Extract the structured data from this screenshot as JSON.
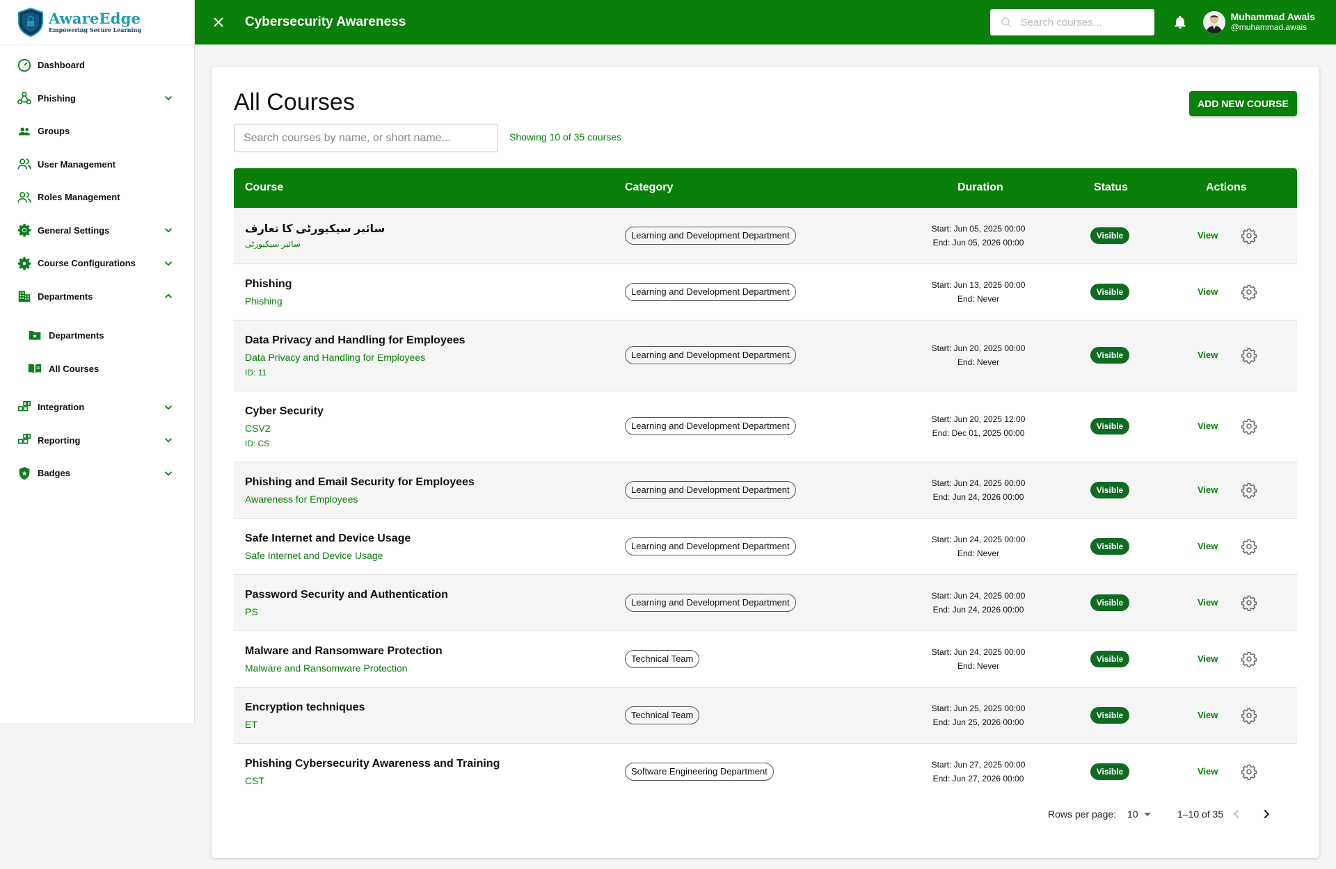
{
  "brand": {
    "name": "AwareEdge",
    "tagline": "Empowering Secure Learning"
  },
  "sidebar": {
    "items": [
      {
        "label": "Dashboard",
        "icon": "gauge-icon",
        "expandable": false
      },
      {
        "label": "Phishing",
        "icon": "webhook-icon",
        "expandable": true,
        "expanded": false
      },
      {
        "label": "Groups",
        "icon": "groups-icon",
        "expandable": false
      },
      {
        "label": "User Management",
        "icon": "users-icon",
        "expandable": false
      },
      {
        "label": "Roles Management",
        "icon": "users-icon",
        "expandable": false
      },
      {
        "label": "General Settings",
        "icon": "gear-icon",
        "expandable": true,
        "expanded": false
      },
      {
        "label": "Course Configurations",
        "icon": "gear-icon",
        "expandable": true,
        "expanded": false
      },
      {
        "label": "Departments",
        "icon": "building-icon",
        "expandable": true,
        "expanded": true
      },
      {
        "label": "Integration",
        "icon": "widgets-icon",
        "expandable": true,
        "expanded": false
      },
      {
        "label": "Reporting",
        "icon": "widgets-icon",
        "expandable": true,
        "expanded": false
      },
      {
        "label": "Badges",
        "icon": "badge-shield-icon",
        "expandable": true,
        "expanded": false
      }
    ],
    "sub_items": [
      {
        "label": "Departments",
        "icon": "folder-star-icon"
      },
      {
        "label": "All Courses",
        "icon": "book-open-icon"
      }
    ]
  },
  "header": {
    "title": "Cybersecurity Awareness",
    "search_placeholder": "Search courses...",
    "user_name": "Muhammad Awais",
    "user_handle": "@muhammad.awais"
  },
  "main": {
    "title": "All Courses",
    "add_button": "ADD NEW COURSE",
    "search_placeholder": "Search courses by name, or short name...",
    "showing": "Showing 10 of 35 courses",
    "columns": [
      "Course",
      "Category",
      "Duration",
      "Status",
      "Actions"
    ],
    "rows": [
      {
        "name": "سائبر سیکیورٹی کا تعارف",
        "short": "سائبر سیکیورٹی",
        "id": "",
        "category": "Learning and Development Department",
        "start": "Start: Jun 05, 2025 00:00",
        "end": "End: Jun 05, 2026 00:00",
        "status": "Visible",
        "action": "View"
      },
      {
        "name": "Phishing",
        "short": "Phishing",
        "id": "",
        "category": "Learning and Development Department",
        "start": "Start: Jun 13, 2025 00:00",
        "end": "End: Never",
        "status": "Visible",
        "action": "View"
      },
      {
        "name": "Data Privacy and Handling for Employees",
        "short": "Data Privacy and Handling for Employees",
        "id": "ID: 11",
        "category": "Learning and Development Department",
        "start": "Start: Jun 20, 2025 00:00",
        "end": "End: Never",
        "status": "Visible",
        "action": "View"
      },
      {
        "name": "Cyber Security",
        "short": "CSV2",
        "id": "ID: CS",
        "category": "Learning and Development Department",
        "start": "Start: Jun 20, 2025 12:00",
        "end": "End: Dec 01, 2025 00:00",
        "status": "Visible",
        "action": "View"
      },
      {
        "name": "Phishing and Email Security for Employees",
        "short": "Awareness for Employees",
        "id": "",
        "category": "Learning and Development Department",
        "start": "Start: Jun 24, 2025 00:00",
        "end": "End: Jun 24, 2026 00:00",
        "status": "Visible",
        "action": "View"
      },
      {
        "name": "Safe Internet and Device Usage",
        "short": "Safe Internet and Device Usage",
        "id": "",
        "category": "Learning and Development Department",
        "start": "Start: Jun 24, 2025 00:00",
        "end": "End: Never",
        "status": "Visible",
        "action": "View"
      },
      {
        "name": "Password Security and Authentication",
        "short": "PS",
        "id": "",
        "category": "Learning and Development Department",
        "start": "Start: Jun 24, 2025 00:00",
        "end": "End: Jun 24, 2026 00:00",
        "status": "Visible",
        "action": "View"
      },
      {
        "name": "Malware and Ransomware Protection",
        "short": "Malware and Ransomware Protection",
        "id": "",
        "category": "Technical Team",
        "start": "Start: Jun 24, 2025 00:00",
        "end": "End: Never",
        "status": "Visible",
        "action": "View"
      },
      {
        "name": "Encryption techniques",
        "short": "ET",
        "id": "",
        "category": "Technical Team",
        "start": "Start: Jun 25, 2025 00:00",
        "end": "End: Jun 25, 2026 00:00",
        "status": "Visible",
        "action": "View"
      },
      {
        "name": "Phishing Cybersecurity Awareness and Training",
        "short": "CST",
        "id": "",
        "category": "Software Engineering Department",
        "start": "Start: Jun 27, 2025 00:00",
        "end": "End: Jun 27, 2026 00:00",
        "status": "Visible",
        "action": "View"
      }
    ],
    "pagination": {
      "rows_label": "Rows per page:",
      "rows_value": "10",
      "range": "1–10 of 35"
    }
  },
  "colors": {
    "primary": "#0a7f0a",
    "status_bg": "#106b22",
    "brand_text": "#1e9bb3"
  }
}
